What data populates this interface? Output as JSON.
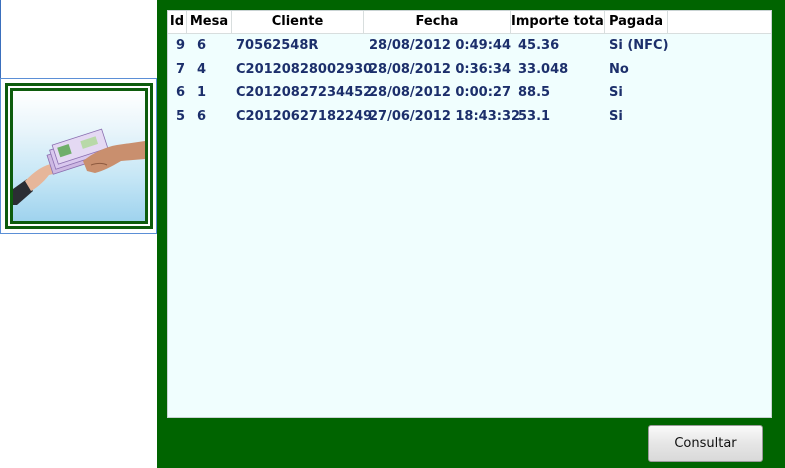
{
  "table": {
    "columns": [
      "Id",
      "Mesa",
      "Cliente",
      "Fecha",
      "Importe total",
      "Pagada"
    ],
    "rows": [
      [
        "9",
        "6",
        "70562548R",
        "28/08/2012 0:49:44",
        "45.36",
        "Si (NFC)"
      ],
      [
        "7",
        "4",
        "C20120828002930",
        "28/08/2012 0:36:34",
        "33.048",
        "No"
      ],
      [
        "6",
        "1",
        "C20120827234452",
        "28/08/2012 0:00:27",
        "88.5",
        "Si"
      ],
      [
        "5",
        "6",
        "C20120627182249",
        "27/06/2012 18:43:32",
        "53.1",
        "Si"
      ]
    ]
  },
  "buttons": {
    "consultar": "Consultar"
  },
  "tile": {
    "image": "money-handover-icon"
  },
  "colors": {
    "panel": "#006400",
    "grid_bg": "#f0fefe",
    "cell_text": "#1c2f6b"
  }
}
